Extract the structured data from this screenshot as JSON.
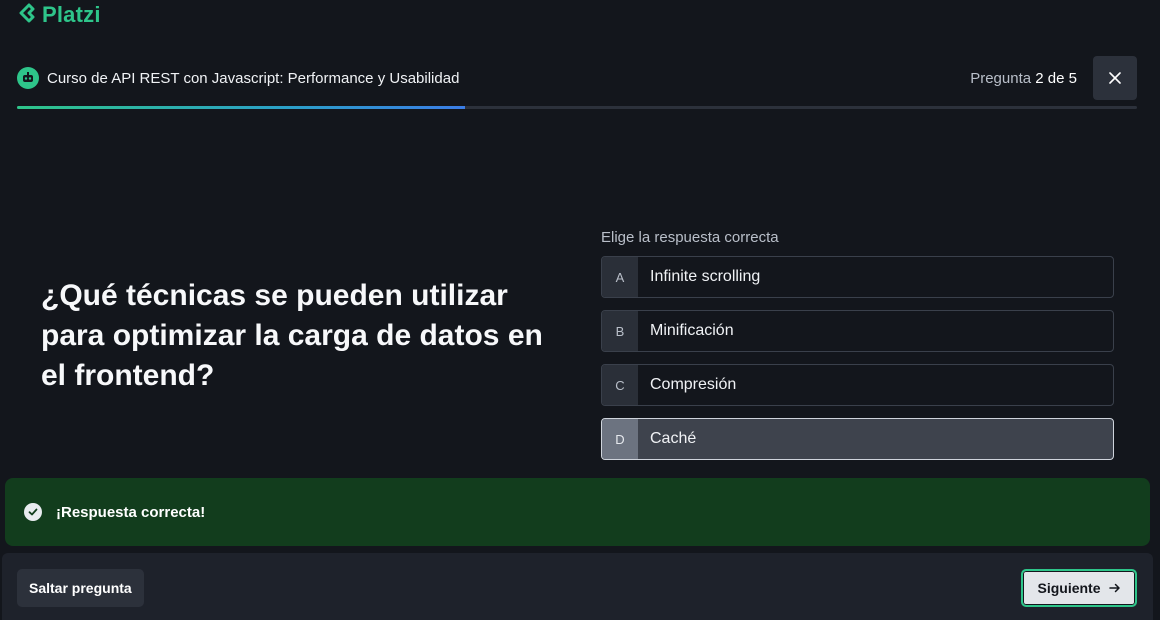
{
  "brand": {
    "logo_text": "Platzi",
    "color": "#2ec58a"
  },
  "header": {
    "course_title": "Curso de API REST con Javascript: Performance y Usabilidad",
    "question_label": "Pregunta",
    "question_current": "2",
    "question_of": "de",
    "question_total": "5",
    "close_icon": "close-icon"
  },
  "progress": {
    "fraction": 0.4
  },
  "quiz": {
    "question": "¿Qué técnicas se pueden utilizar para optimizar la carga de datos en el frontend?",
    "instructions": "Elige la respuesta correcta",
    "options": [
      {
        "letter": "A",
        "text": "Infinite scrolling"
      },
      {
        "letter": "B",
        "text": "Minificación"
      },
      {
        "letter": "C",
        "text": "Compresión"
      },
      {
        "letter": "D",
        "text": "Caché"
      }
    ],
    "selected": "D"
  },
  "feedback": {
    "text": "¡Respuesta correcta!",
    "icon": "check-circle-icon",
    "color": "#123d1d"
  },
  "footer": {
    "skip_label": "Saltar pregunta",
    "next_label": "Siguiente",
    "next_icon": "arrow-right-icon"
  }
}
